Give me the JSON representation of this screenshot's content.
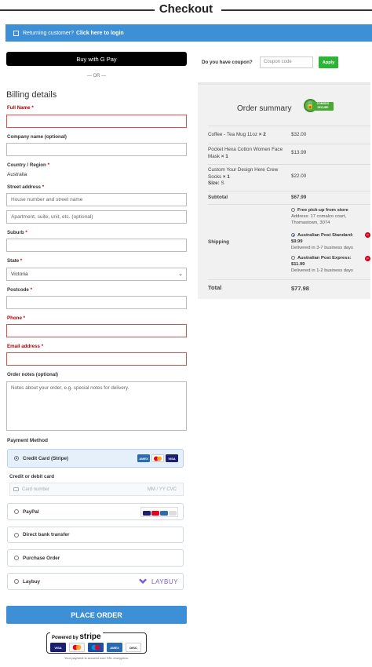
{
  "page": {
    "title": "Checkout"
  },
  "login_bar": {
    "prompt": "Returning customer?",
    "link": "Click here to login"
  },
  "express": {
    "gpay_label": "Buy with  G Pay",
    "or_label": "— OR —"
  },
  "billing": {
    "heading": "Billing details",
    "full_name": {
      "label": "Full Name",
      "value": ""
    },
    "company": {
      "label": "Company name (optional)",
      "value": ""
    },
    "country": {
      "label": "Country / Region",
      "value": "Australia"
    },
    "street": {
      "label": "Street address",
      "placeholder1": "House number and street name",
      "placeholder2": "Apartment, suite, unit, etc. (optional)"
    },
    "suburb": {
      "label": "Suburb",
      "value": ""
    },
    "state": {
      "label": "State",
      "value": "Victoria"
    },
    "postcode": {
      "label": "Postcode",
      "value": ""
    },
    "phone": {
      "label": "Phone",
      "value": ""
    },
    "email": {
      "label": "Email address",
      "value": ""
    },
    "notes": {
      "label": "Order notes (optional)",
      "placeholder": "Notes about your order, e.g. special notes for delivery."
    }
  },
  "payment": {
    "heading": "Payment Method",
    "methods": [
      {
        "label": "Credit Card (Stripe)",
        "selected": true
      },
      {
        "label": "PayPal",
        "selected": false
      },
      {
        "label": "Direct bank transfer",
        "selected": false
      },
      {
        "label": "Purchase Order",
        "selected": false
      },
      {
        "label": "Laybuy",
        "selected": false
      }
    ],
    "card_label": "Credit or debit card",
    "card_placeholder": "Card number",
    "card_expiry_cvc": "MM / YY  CVC",
    "laybuy_logo": "LAYBUY",
    "place_order": "PLACE ORDER",
    "powered_by": "Powered by",
    "stripe_word": "stripe",
    "secure_note": "Your payment is secured over SSL encryption."
  },
  "coupon": {
    "label": "Do you have coupon?",
    "placeholder": "Coupon code",
    "apply": "Apply"
  },
  "summary": {
    "title": "Order summary",
    "badge_text": "COMODO SECURE",
    "items": [
      {
        "name": "Coffee - Tea Mug 11oz",
        "qty": "× 2",
        "price": "$32.00"
      },
      {
        "name": "Pocket Hexa Cotton Women Face Mask",
        "qty": "× 1",
        "price": "$13.99"
      },
      {
        "name": "Custom Your Design Here Crew Socks",
        "qty": "× 1",
        "size_label": "Size:",
        "size_value": "S",
        "price": "$22.00"
      }
    ],
    "subtotal_label": "Subtotal",
    "subtotal_value": "$67.99",
    "shipping_label": "Shipping",
    "shipping_options": [
      {
        "title": "Free pick-up from store",
        "detail": "Address: 17 comalco court, Thomastown, 3074",
        "selected": false
      },
      {
        "title": "Australian Post Standard:",
        "price": "$9.99",
        "detail": "Delivered in 3-7 business days",
        "selected": true
      },
      {
        "title": "Australian Post Express:",
        "price": "$11.99",
        "detail": "Delivered in 1-2 business days",
        "selected": false
      }
    ],
    "total_label": "Total",
    "total_value": "$77.98"
  },
  "colors": {
    "accent": "#3d8fd6",
    "error": "#d9534f",
    "apply": "#2db336"
  }
}
